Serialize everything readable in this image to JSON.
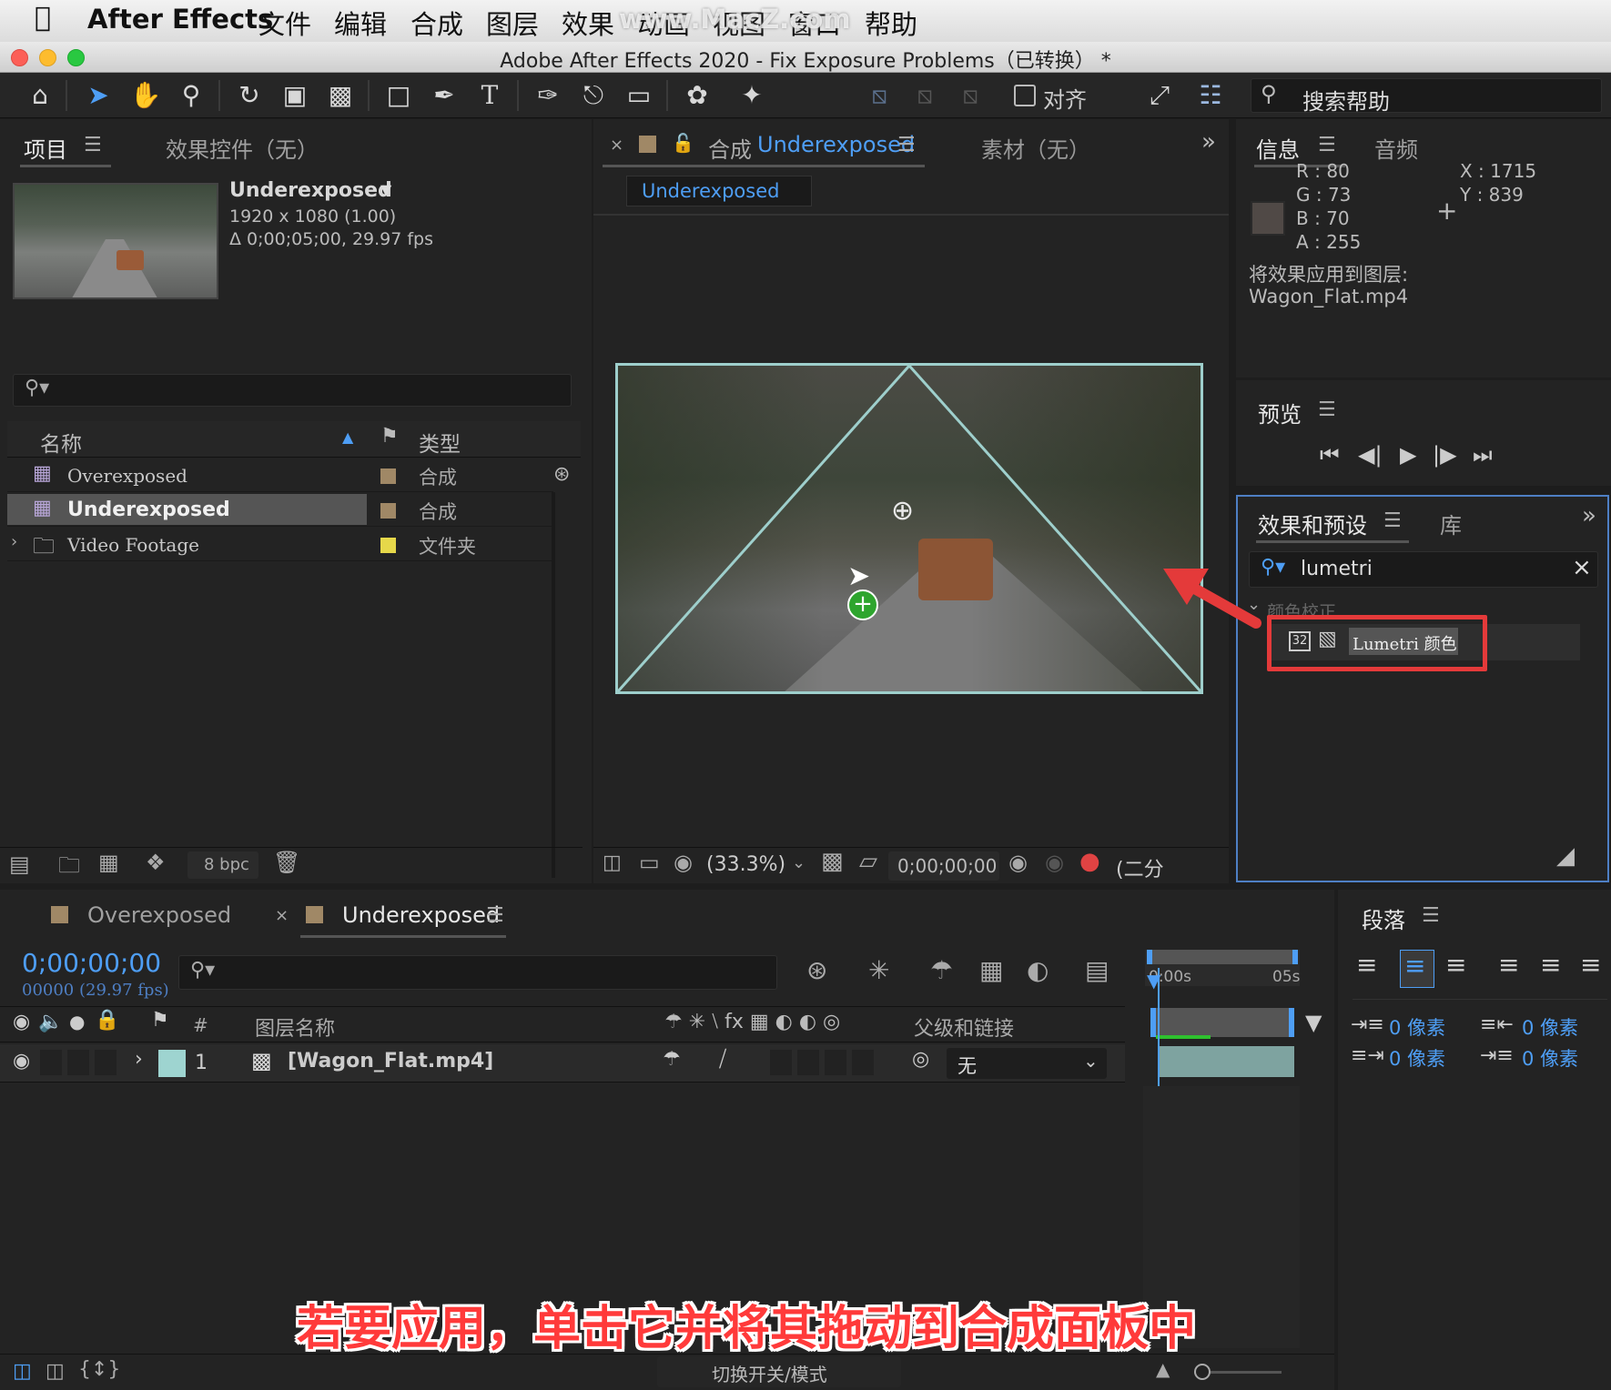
{
  "menubar": {
    "app": "After Effects",
    "items": [
      "文件",
      "编辑",
      "合成",
      "图层",
      "效果",
      "动画",
      "视图",
      "窗口",
      "帮助"
    ],
    "watermark": "www.MacZ.com"
  },
  "window": {
    "title": "Adobe After Effects 2020 - Fix Exposure Problems（已转换） *"
  },
  "toolbar": {
    "snap_label": "对齐",
    "search_help": "搜索帮助"
  },
  "project_panel": {
    "tabs": [
      "项目",
      "效果控件（无）"
    ],
    "selected_item": {
      "name": "Underexposed",
      "dimensions": "1920 x 1080 (1.00)",
      "duration": "Δ 0;00;05;00, 29.97 fps"
    },
    "columns": {
      "name": "名称",
      "type": "类型"
    },
    "rows": [
      {
        "name": "Overexposed",
        "type": "合成",
        "color": "#a08866"
      },
      {
        "name": "Underexposed",
        "type": "合成",
        "color": "#a08866"
      },
      {
        "name": "Video Footage",
        "type": "文件夹",
        "color": "#e6d84a"
      }
    ],
    "bpc": "8 bpc"
  },
  "comp_panel": {
    "tab_prefix": "合成",
    "tab_name": "Underexposed",
    "footage_tab": "素材（无）",
    "subtab": "Underexposed",
    "zoom": "(33.3%)",
    "timecode": "0;00;00;00",
    "resolution": "(二分"
  },
  "info_panel": {
    "tabs": [
      "信息",
      "音频"
    ],
    "r": "R :  80",
    "g": "G :  73",
    "b": "B :  70",
    "a": "A :  255",
    "x": "X : 1715",
    "y": "Y :  839",
    "apply_line1": "将效果应用到图层:",
    "apply_line2": "Wagon_Flat.mp4",
    "swatch_color": "#504946"
  },
  "preview_panel": {
    "title": "预览"
  },
  "effects_panel": {
    "tabs": [
      "效果和预设",
      "库"
    ],
    "search_value": "lumetri",
    "category": "颜色校正",
    "effect": "Lumetri 颜色",
    "badge": "32"
  },
  "timeline": {
    "tabs": [
      "Overexposed",
      "Underexposed"
    ],
    "timecode": "0;00;00;00",
    "frames": "00000 (29.97 fps)",
    "layer_name_header": "图层名称",
    "parent_header": "父级和链接",
    "num_header": "#",
    "layer": {
      "index": "1",
      "name": "[Wagon_Flat.mp4]",
      "parent": "无",
      "label_color": "#9ed4d0"
    },
    "ruler": {
      "start": "0:00s",
      "end": "05s"
    },
    "toggle_label": "切换开关/模式"
  },
  "paragraph_panel": {
    "title": "段落",
    "indent_left": "0 像素",
    "indent_first": "0 像素",
    "space_before": "0 像素",
    "space_after": "0 像素"
  },
  "caption": "若要应用，单击它并将其拖动到合成面板中"
}
